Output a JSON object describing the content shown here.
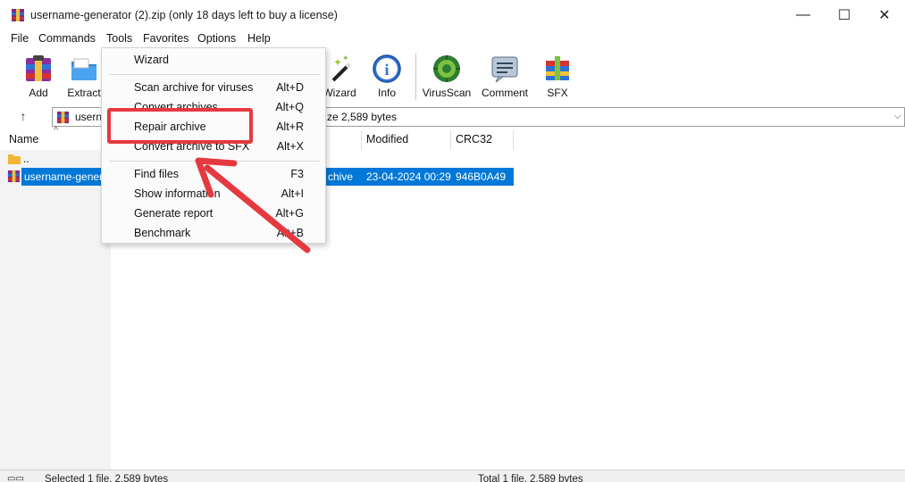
{
  "window": {
    "title": "username-generator (2).zip (only 18 days left to buy a license)",
    "controls": {
      "minimize": "—",
      "maximize": "☐",
      "close": "✕"
    }
  },
  "menubar": {
    "items": [
      "File",
      "Commands",
      "Tools",
      "Favorites",
      "Options",
      "Help"
    ]
  },
  "toolbar": {
    "buttons": [
      {
        "label": "Add",
        "icon": "winrar-add-icon"
      },
      {
        "label": "Extract",
        "icon": "extract-folder-icon"
      },
      {
        "label": "Wizard",
        "icon": "wizard-wand-icon"
      },
      {
        "label": "Info",
        "icon": "info-icon"
      },
      {
        "label": "VirusScan",
        "icon": "virus-scan-icon"
      },
      {
        "label": "Comment",
        "icon": "comment-icon"
      },
      {
        "label": "SFX",
        "icon": "sfx-archive-icon"
      }
    ]
  },
  "address": {
    "path_start": "usern",
    "path_end": "ze 2,589 bytes",
    "up_arrow": "↑",
    "dropdown": "⌵"
  },
  "columns": {
    "name": "Name",
    "modified": "Modified",
    "crc": "CRC32",
    "sort_arrow": "^"
  },
  "files": [
    {
      "name": "..",
      "type": "",
      "modified": "",
      "crc": ""
    },
    {
      "name": "username-gener",
      "type": "chive",
      "modified": "23-04-2024 00:29",
      "crc": "946B0A49"
    }
  ],
  "tools_menu": {
    "items": [
      {
        "label": "Wizard",
        "shortcut": ""
      },
      {
        "label": "Scan archive for viruses",
        "shortcut": "Alt+D"
      },
      {
        "label": "Convert archives",
        "shortcut": "Alt+Q"
      },
      {
        "label": "Repair archive",
        "shortcut": "Alt+R"
      },
      {
        "label": "Convert archive to SFX",
        "shortcut": "Alt+X"
      },
      {
        "label": "Find files",
        "shortcut": "F3"
      },
      {
        "label": "Show information",
        "shortcut": "Alt+I"
      },
      {
        "label": "Generate report",
        "shortcut": "Alt+G"
      },
      {
        "label": "Benchmark",
        "shortcut": "Alt+B"
      }
    ]
  },
  "status": {
    "left": "Selected 1 file, 2,589 bytes",
    "right": "Total 1 file, 2,589 bytes"
  },
  "colors": {
    "selection": "#0078d7",
    "annotation_red": "#e53940"
  }
}
